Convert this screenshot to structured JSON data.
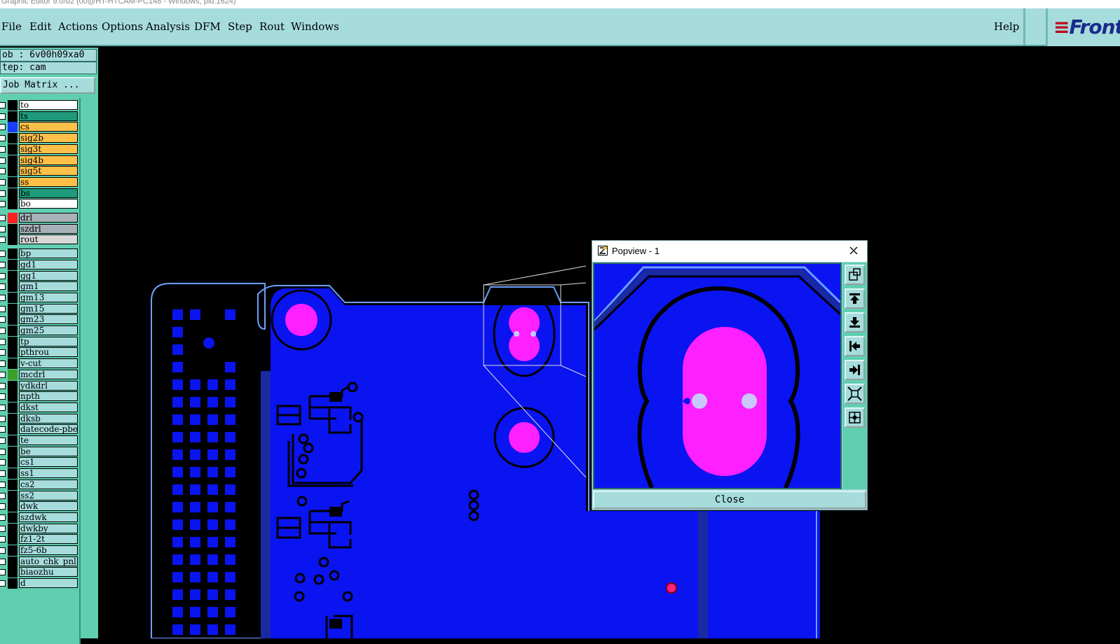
{
  "window": {
    "title": "Graphic Editor 9.0/b2 (00@HT-HTCAM-PC148 - Windows, pid:1624)"
  },
  "menu": {
    "items": [
      "File",
      "Edit",
      "Actions",
      "Options",
      "Analysis",
      "DFM",
      "Step",
      "Rout",
      "Windows"
    ],
    "help": "Help",
    "logo": "Front"
  },
  "sidebar": {
    "job": "ob : 6v00h09xa0",
    "step": "tep: cam",
    "matrix_button": "Job Matrix ...",
    "layers": [
      {
        "name": "to",
        "bg": "#ffffff",
        "swatch": "#000000"
      },
      {
        "name": "ts",
        "bg": "#1f9a7a",
        "swatch": "#000000"
      },
      {
        "name": "cs",
        "bg": "#ffc04a",
        "swatch": "#1a3cff"
      },
      {
        "name": "sig2b",
        "bg": "#ffc04a",
        "swatch": "#000000"
      },
      {
        "name": "sig3t",
        "bg": "#ffc04a",
        "swatch": "#000000"
      },
      {
        "name": "sig4b",
        "bg": "#ffc04a",
        "swatch": "#000000"
      },
      {
        "name": "sig5t",
        "bg": "#ffc04a",
        "swatch": "#000000"
      },
      {
        "name": "ss",
        "bg": "#ffc04a",
        "swatch": "#000000"
      },
      {
        "name": "bs",
        "bg": "#1f9a7a",
        "swatch": "#000000"
      },
      {
        "name": "bo",
        "bg": "#ffffff",
        "swatch": "#000000"
      },
      {
        "name": "drl",
        "bg": "#a8b0b8",
        "swatch": "#ff2020"
      },
      {
        "name": "szdrl",
        "bg": "#a8b0b8",
        "swatch": "#000000"
      },
      {
        "name": "rout",
        "bg": "#d8d8d8",
        "swatch": "#000000"
      },
      {
        "name": "bp",
        "bg": "#a6dcdc",
        "swatch": "#000000"
      },
      {
        "name": "gd1",
        "bg": "#a6dcdc",
        "swatch": "#000000"
      },
      {
        "name": "gg1",
        "bg": "#a6dcdc",
        "swatch": "#000000"
      },
      {
        "name": "gm1",
        "bg": "#a6dcdc",
        "swatch": "#000000"
      },
      {
        "name": "gm13",
        "bg": "#a6dcdc",
        "swatch": "#000000"
      },
      {
        "name": "gm15",
        "bg": "#a6dcdc",
        "swatch": "#000000"
      },
      {
        "name": "gm23",
        "bg": "#a6dcdc",
        "swatch": "#000000"
      },
      {
        "name": "gm25",
        "bg": "#a6dcdc",
        "swatch": "#000000"
      },
      {
        "name": "tp",
        "bg": "#a6dcdc",
        "swatch": "#000000"
      },
      {
        "name": "pthrou",
        "bg": "#a6dcdc",
        "swatch": "#000000"
      },
      {
        "name": "v-cut",
        "bg": "#a6dcdc",
        "swatch": "#000000"
      },
      {
        "name": "mcdrl",
        "bg": "#a6dcdc",
        "swatch": "#3aa02a"
      },
      {
        "name": "ydkdrl",
        "bg": "#a6dcdc",
        "swatch": "#000000"
      },
      {
        "name": "npth",
        "bg": "#a6dcdc",
        "swatch": "#000000"
      },
      {
        "name": "dkst",
        "bg": "#a6dcdc",
        "swatch": "#000000"
      },
      {
        "name": "dksb",
        "bg": "#a6dcdc",
        "swatch": "#000000"
      },
      {
        "name": "datecode-pbe",
        "bg": "#a6dcdc",
        "swatch": "#000000"
      },
      {
        "name": "te",
        "bg": "#a6dcdc",
        "swatch": "#000000"
      },
      {
        "name": "be",
        "bg": "#a6dcdc",
        "swatch": "#000000"
      },
      {
        "name": "cs1",
        "bg": "#a6dcdc",
        "swatch": "#000000"
      },
      {
        "name": "ss1",
        "bg": "#a6dcdc",
        "swatch": "#000000"
      },
      {
        "name": "cs2",
        "bg": "#a6dcdc",
        "swatch": "#000000"
      },
      {
        "name": "ss2",
        "bg": "#a6dcdc",
        "swatch": "#000000"
      },
      {
        "name": "dwk",
        "bg": "#a6dcdc",
        "swatch": "#000000"
      },
      {
        "name": "szdwk",
        "bg": "#a6dcdc",
        "swatch": "#000000"
      },
      {
        "name": "dwkby",
        "bg": "#a6dcdc",
        "swatch": "#000000"
      },
      {
        "name": "fz1-2t",
        "bg": "#a6dcdc",
        "swatch": "#000000"
      },
      {
        "name": "fz5-6b",
        "bg": "#a6dcdc",
        "swatch": "#000000"
      },
      {
        "name": "auto_chk_pnl",
        "bg": "#a6dcdc",
        "swatch": "#000000"
      },
      {
        "name": "biaozhu",
        "bg": "#a6dcdc",
        "swatch": "#000000"
      },
      {
        "name": "d",
        "bg": "#a6dcdc",
        "swatch": "#000000"
      }
    ]
  },
  "popview": {
    "title": "Popview - 1",
    "close_label": "Close",
    "tools": [
      "zoom-window-icon",
      "pan-up-icon",
      "pan-down-icon",
      "pan-left-icon",
      "pan-right-icon",
      "zoom-out-icon",
      "zoom-in-icon"
    ]
  },
  "colors": {
    "board": "#0a14f0",
    "pad": "#ff20ff",
    "panel": "#a6dcdc",
    "accent": "#5fcfb0"
  }
}
